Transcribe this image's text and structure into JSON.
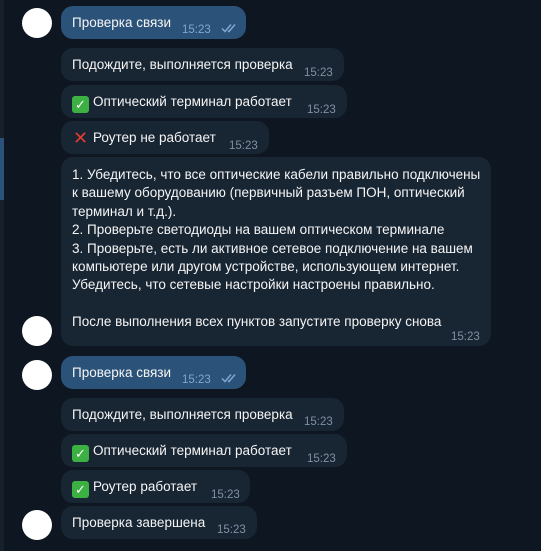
{
  "chat": {
    "msg1": {
      "text": "Проверка связи",
      "time": "15:23"
    },
    "msg2": {
      "text": "Подождите, выполняется проверка",
      "time": "15:23"
    },
    "msg3": {
      "text": "Оптический терминал работает",
      "time": "15:23",
      "icon": "check-mark-icon"
    },
    "msg4": {
      "text": "Роутер не работает",
      "time": "15:23",
      "icon": "cross-mark-icon"
    },
    "msg5": {
      "lines": [
        "1. Убедитесь, что все оптические кабели правильно подключены",
        "к вашему оборудованию (первичный разъем ПОН, оптический",
        "терминал и т.д.).",
        "2. Проверьте светодиоды на вашем оптическом терминале",
        "3. Проверьте, есть ли активное сетевое подключение на вашем",
        "компьютере или другом устройстве, использующем интернет.",
        "Убедитесь, что сетевые настройки настроены правильно.",
        "",
        "После выполнения всех пунктов запустите проверку снова"
      ],
      "time": "15:23"
    },
    "msg6": {
      "text": "Проверка связи",
      "time": "15:23"
    },
    "msg7": {
      "text": "Подождите, выполняется проверка",
      "time": "15:23"
    },
    "msg8": {
      "text": "Оптический терминал работает",
      "time": "15:23",
      "icon": "check-mark-icon"
    },
    "msg9": {
      "text": "Роутер работает",
      "time": "15:23",
      "icon": "check-mark-icon"
    },
    "msg10": {
      "text": "Проверка завершена",
      "time": "15:23"
    }
  },
  "colors": {
    "background": "#0e1621",
    "incoming_bubble": "#182533",
    "outgoing_bubble": "#2b5278",
    "time_text": "#7f91a4",
    "read_ticks": "#7da8d3"
  }
}
